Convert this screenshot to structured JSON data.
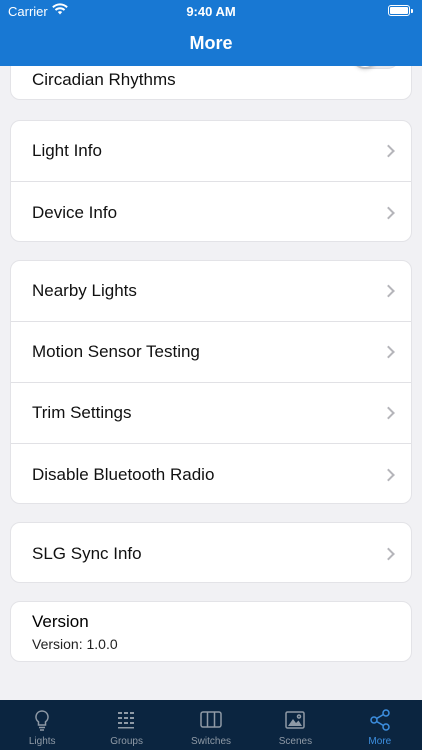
{
  "status_bar": {
    "carrier": "Carrier",
    "time": "9:40 AM"
  },
  "header": {
    "title": "More"
  },
  "section_top": {
    "label": "Circadian Rhythms",
    "toggle_on": false
  },
  "section_info": {
    "items": [
      {
        "label": "Light Info"
      },
      {
        "label": "Device Info"
      }
    ]
  },
  "section_tools": {
    "items": [
      {
        "label": "Nearby Lights"
      },
      {
        "label": "Motion Sensor Testing"
      },
      {
        "label": "Trim Settings"
      },
      {
        "label": "Disable Bluetooth Radio"
      }
    ]
  },
  "section_sync": {
    "items": [
      {
        "label": "SLG Sync Info"
      }
    ]
  },
  "version": {
    "title": "Version",
    "value": "Version: 1.0.0"
  },
  "tabbar": {
    "tabs": [
      {
        "label": "Lights",
        "icon": "lightbulb-icon"
      },
      {
        "label": "Groups",
        "icon": "groups-icon"
      },
      {
        "label": "Switches",
        "icon": "switches-icon"
      },
      {
        "label": "Scenes",
        "icon": "scenes-icon"
      },
      {
        "label": "More",
        "icon": "share-icon",
        "active": true
      }
    ]
  },
  "colors": {
    "header": "#1878d3",
    "tabbar": "#0b2540",
    "active_tab": "#3d8fe0",
    "inactive_tab": "#8f9aa6"
  }
}
